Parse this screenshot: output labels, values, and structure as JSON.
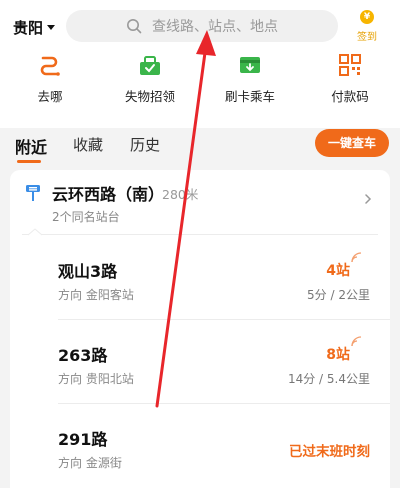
{
  "header": {
    "city": "贵阳",
    "search_placeholder": "查线路、站点、地点",
    "checkin": {
      "coin": "¥",
      "label": "签到"
    }
  },
  "shortcuts": [
    {
      "label": "去哪",
      "icon": "route-icon"
    },
    {
      "label": "失物招领",
      "icon": "lost-found-icon"
    },
    {
      "label": "刷卡乘车",
      "icon": "card-ride-icon"
    },
    {
      "label": "付款码",
      "icon": "qr-code-icon"
    }
  ],
  "tabs": [
    {
      "label": "附近",
      "active": true
    },
    {
      "label": "收藏",
      "active": false
    },
    {
      "label": "历史",
      "active": false
    }
  ],
  "query_button": "一键查车",
  "stop": {
    "name": "云环西路（南）",
    "distance": "280米",
    "sub": "2个同名站台"
  },
  "routes": [
    {
      "name": "观山3路",
      "direction": "方向 金阳客站",
      "stops": "4站",
      "eta": "5分 / 2公里"
    },
    {
      "name": "263路",
      "direction": "方向 贵阳北站",
      "stops": "8站",
      "eta": "14分 / 5.4公里"
    },
    {
      "name": "291路",
      "direction": "方向 金源街",
      "status": "已过末班时刻"
    }
  ],
  "colors": {
    "accent": "#f06a1a",
    "arrow": "#e8262b",
    "background": "#f3f3f3"
  }
}
